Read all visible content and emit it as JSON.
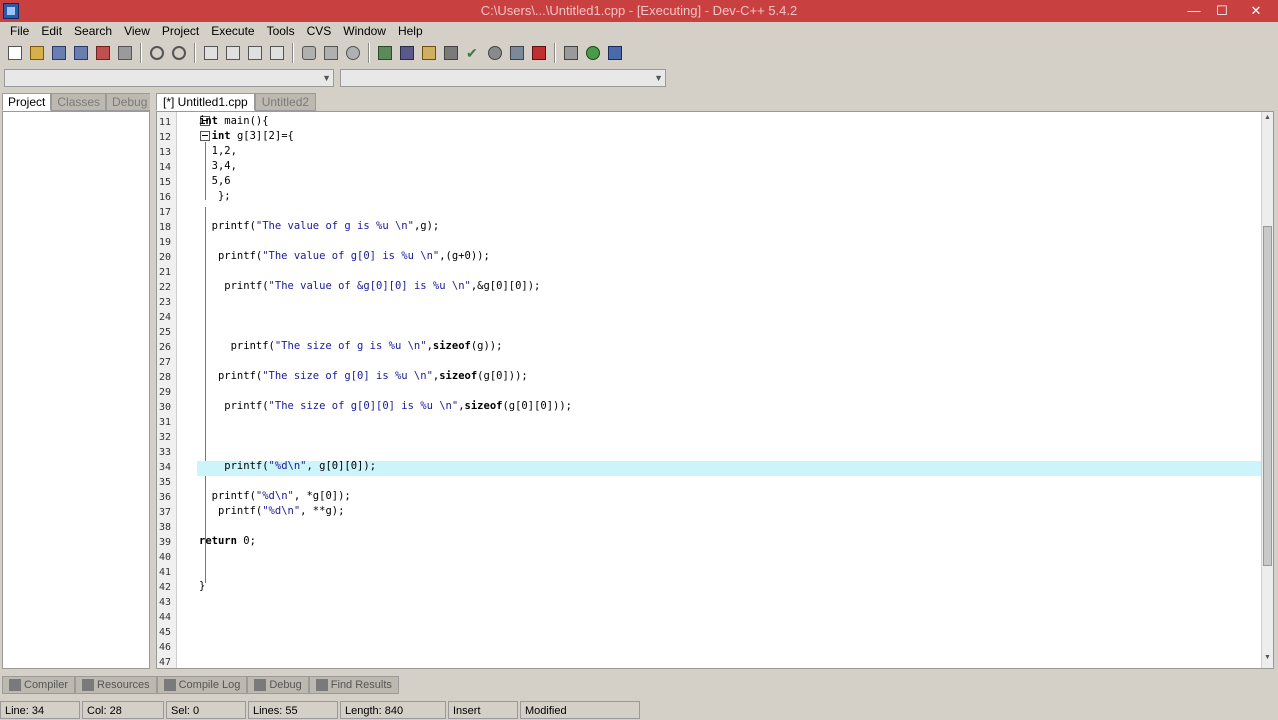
{
  "window": {
    "title": "C:\\Users\\...\\Untitled1.cpp - [Executing] - Dev-C++ 5.4.2",
    "min": "—",
    "max": "☐",
    "close": "✕"
  },
  "menu": [
    {
      "label": "File"
    },
    {
      "label": "Edit"
    },
    {
      "label": "Search"
    },
    {
      "label": "View"
    },
    {
      "label": "Project"
    },
    {
      "label": "Execute"
    },
    {
      "label": "Tools"
    },
    {
      "label": "CVS"
    },
    {
      "label": "Window"
    },
    {
      "label": "Help"
    }
  ],
  "left_tabs": [
    "Project",
    "Classes",
    "Debug"
  ],
  "editor_tabs": [
    "[*] Untitled1.cpp",
    "Untitled2"
  ],
  "line_numbers": [
    "11",
    "12",
    "13",
    "14",
    "15",
    "16",
    "17",
    "18",
    "19",
    "20",
    "21",
    "22",
    "23",
    "24",
    "25",
    "26",
    "27",
    "28",
    "29",
    "30",
    "31",
    "32",
    "33",
    "34",
    "35",
    "36",
    "37",
    "38",
    "39",
    "40",
    "41",
    "42",
    "43",
    "44",
    "45",
    "46",
    "47"
  ],
  "code": [
    {
      "ln": "11",
      "text": "int main(){"
    },
    {
      "ln": "12",
      "text": "  int g[3][2]={"
    },
    {
      "ln": "13",
      "text": "  1,2,"
    },
    {
      "ln": "14",
      "text": "  3,4,"
    },
    {
      "ln": "15",
      "text": "  5,6"
    },
    {
      "ln": "16",
      "text": "   };"
    },
    {
      "ln": "17",
      "text": ""
    },
    {
      "ln": "18",
      "text": "  printf(\"The value of g is %u \\n\",g);"
    },
    {
      "ln": "19",
      "text": ""
    },
    {
      "ln": "20",
      "text": "   printf(\"The value of g[0] is %u \\n\",(g+0));"
    },
    {
      "ln": "21",
      "text": ""
    },
    {
      "ln": "22",
      "text": "    printf(\"The value of &g[0][0] is %u \\n\",&g[0][0]);"
    },
    {
      "ln": "23",
      "text": ""
    },
    {
      "ln": "24",
      "text": ""
    },
    {
      "ln": "25",
      "text": ""
    },
    {
      "ln": "26",
      "text": "     printf(\"The size of g is %u \\n\",sizeof(g));"
    },
    {
      "ln": "27",
      "text": ""
    },
    {
      "ln": "28",
      "text": "   printf(\"The size of g[0] is %u \\n\",sizeof(g[0]));"
    },
    {
      "ln": "29",
      "text": ""
    },
    {
      "ln": "30",
      "text": "    printf(\"The size of g[0][0] is %u \\n\",sizeof(g[0][0]));"
    },
    {
      "ln": "31",
      "text": ""
    },
    {
      "ln": "32",
      "text": ""
    },
    {
      "ln": "33",
      "text": ""
    },
    {
      "ln": "34",
      "text": "    printf(\"%d\\n\", g[0][0]);"
    },
    {
      "ln": "35",
      "text": ""
    },
    {
      "ln": "36",
      "text": "  printf(\"%d\\n\", *g[0]);"
    },
    {
      "ln": "37",
      "text": "   printf(\"%d\\n\", **g);"
    },
    {
      "ln": "38",
      "text": ""
    },
    {
      "ln": "39",
      "text": "return 0;"
    },
    {
      "ln": "40",
      "text": ""
    },
    {
      "ln": "41",
      "text": ""
    },
    {
      "ln": "42",
      "text": "}"
    },
    {
      "ln": "43",
      "text": ""
    },
    {
      "ln": "44",
      "text": ""
    },
    {
      "ln": "45",
      "text": ""
    },
    {
      "ln": "46",
      "text": ""
    },
    {
      "ln": "47",
      "text": ""
    }
  ],
  "current_line": "34",
  "bottom_tabs": [
    "Compiler",
    "Resources",
    "Compile Log",
    "Debug",
    "Find Results"
  ],
  "status": {
    "line": "Line: 34",
    "col": "Col: 28",
    "sel": "Sel: 0",
    "lines": "Lines: 55",
    "length": "Length: 840",
    "mode": "Insert",
    "state": "Modified"
  }
}
